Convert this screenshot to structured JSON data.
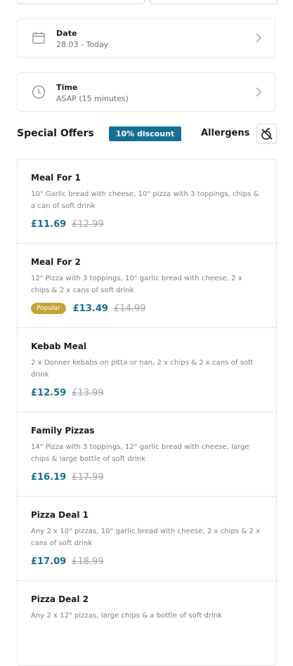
{
  "date_picker": {
    "label": "Date",
    "value": "28.03 - Today"
  },
  "time_picker": {
    "label": "Time",
    "value": "ASAP (15 minutes)"
  },
  "special_offers": {
    "title": "Special Offers",
    "discount_badge": "10% discount",
    "allergens_label": "Allergens",
    "allergens_icon": "allergens-icon",
    "accent_color": "#166f93",
    "popular_color": "#c4a43a"
  },
  "offers": [
    {
      "name": "Meal For 1",
      "description": "10\" Garlic bread with cheese, 10\" pizza with 3 toppings, chips & a can of soft drink",
      "badge": "",
      "price": "£11.69",
      "old_price": "£12.99"
    },
    {
      "name": "Meal For 2",
      "description": "12\" Pizza with 3 toppings, 10\" garlic bread with cheese, 2 x chips & 2 x cans of soft drink",
      "badge": "Popular",
      "price": "£13.49",
      "old_price": "£14.99"
    },
    {
      "name": "Kebab Meal",
      "description": "2 x Donner kebabs on pitta or nan, 2 x chips & 2 x cans of soft drink",
      "badge": "",
      "price": "£12.59",
      "old_price": "£13.99"
    },
    {
      "name": "Family Pizzas",
      "description": "14\" Pizza with 3 toppings, 12\" garlic bread with cheese, large chips & large bottle of soft drink",
      "badge": "",
      "price": "£16.19",
      "old_price": "£17.99"
    },
    {
      "name": "Pizza Deal 1",
      "description": "Any 2 x 10\" pizzas, 10\" garlic bread with cheese, 2 x chips & 2 x cans of soft drink",
      "badge": "",
      "price": "£17.09",
      "old_price": "£18.99"
    },
    {
      "name": "Pizza Deal 2",
      "description": "Any 2 x 12\" pizzas, large chips & a bottle of soft drink",
      "badge": "",
      "price": "",
      "old_price": ""
    }
  ]
}
